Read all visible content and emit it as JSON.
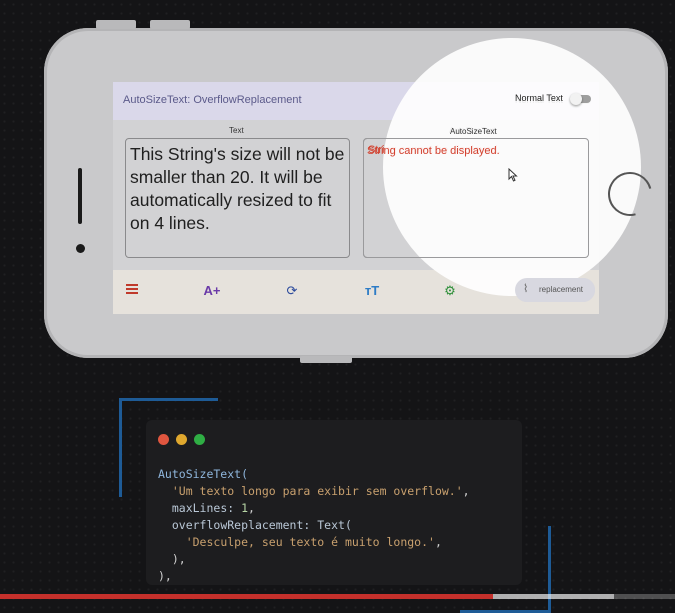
{
  "app": {
    "title": "AutoSizeText: OverflowReplacement",
    "switch_label": "Normal Text",
    "switch_on": false
  },
  "columns": {
    "left_label": "Text",
    "right_label": "AutoSizeText"
  },
  "left_text": "This String's size will not be smaller than 20. It will be automatically resized to fit on 4 lines.",
  "replacement_text": "String cannot be displayed.",
  "bottom_bar": {
    "icons": [
      "menu-icon",
      "font-size-up-icon",
      "refresh-icon",
      "text-size-icon",
      "settings-icon"
    ],
    "pill_label": "replacement",
    "pill_icon": "replacement-icon"
  },
  "colors": {
    "accent": "#5b5a8a",
    "error_text": "#d2402e",
    "code_string": "#c8a06e",
    "code_identifier": "#8fb6dc"
  },
  "code": {
    "line1": "AutoSizeText(",
    "line2_str": "'Um texto longo para exibir sem overflow.'",
    "line3_key": "maxLines: ",
    "line3_val": "1",
    "line4": "overflowReplacement: Text(",
    "line5_str": "'Desculpe, seu texto é muito longo.'",
    "line6": "),",
    "line7": "),"
  },
  "video_progress": {
    "played": 0.73,
    "buffered": 0.91
  }
}
